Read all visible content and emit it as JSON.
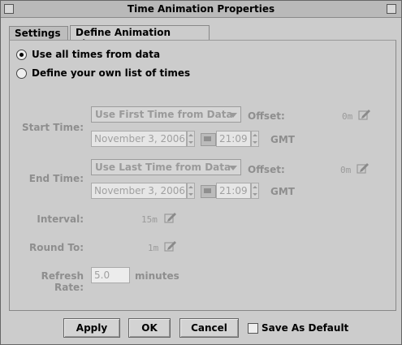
{
  "window": {
    "title": "Time Animation Properties"
  },
  "tabs": [
    {
      "label": "Settings",
      "active": false
    },
    {
      "label": "Define Animation Times",
      "active": true
    }
  ],
  "mode": {
    "use_all": "Use all times from data",
    "define_own": "Define your own list of times",
    "selected": "use_all"
  },
  "start": {
    "label": "Start Time:",
    "combo": "Use First Time from Data",
    "offset_label": "Offset:",
    "offset_value": "0m",
    "date": "November 3, 2006",
    "time": "21:09",
    "tz": "GMT"
  },
  "end": {
    "label": "End Time:",
    "combo": "Use Last Time from Data",
    "offset_label": "Offset:",
    "offset_value": "0m",
    "date": "November 3, 2006",
    "time": "21:09",
    "tz": "GMT"
  },
  "interval": {
    "label": "Interval:",
    "value": "15m"
  },
  "round_to": {
    "label": "Round To:",
    "value": "1m"
  },
  "refresh": {
    "label": "Refresh Rate:",
    "value": "5.0",
    "unit": "minutes"
  },
  "buttons": {
    "apply": "Apply",
    "ok": "OK",
    "cancel": "Cancel"
  },
  "save_default": {
    "label": "Save As Default",
    "checked": false
  },
  "icons": {
    "edit": "pencil-edit-icon",
    "calendar": "calendar-icon"
  }
}
